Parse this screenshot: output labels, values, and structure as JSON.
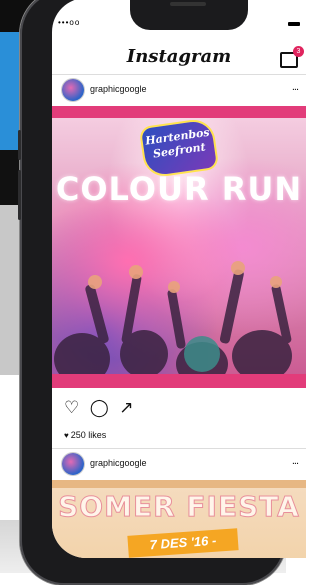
{
  "status": {
    "signal": "•••oo"
  },
  "header": {
    "app_title": "Instagram",
    "inbox_badge": "3"
  },
  "post1": {
    "username": "graphicgoogle",
    "more": "...",
    "image": {
      "logo_line1": "Hartenbos",
      "logo_line2": "Seefront",
      "title": "COLOUR RUN"
    },
    "actions": {
      "like_icon": "heart-icon",
      "comment_icon": "comment-icon",
      "share_icon": "share-icon"
    },
    "likes": "250 likes"
  },
  "post2": {
    "username": "graphicgoogle",
    "more": "...",
    "image": {
      "title": "SOMER FIESTA",
      "date": "7 DES '16 -"
    }
  }
}
